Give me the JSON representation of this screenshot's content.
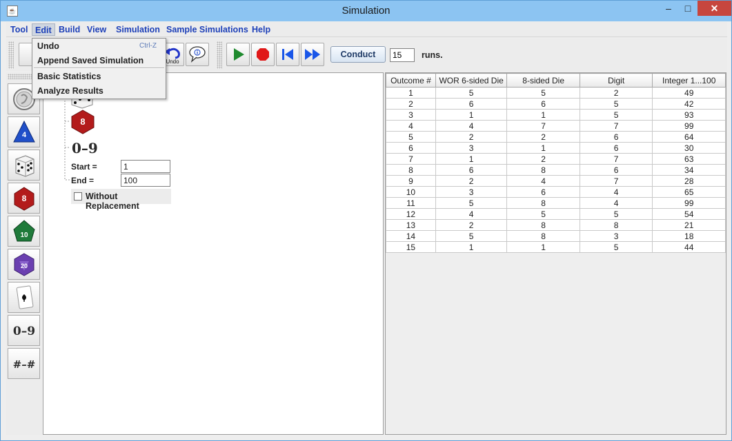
{
  "window": {
    "title": "Simulation",
    "minimize": "–",
    "maximize": "□",
    "close": "✕"
  },
  "menubar": {
    "items": [
      "Tool",
      "Edit",
      "Build",
      "View",
      "Simulation",
      "Sample Simulations",
      "Help"
    ],
    "active": "Edit"
  },
  "edit_menu": {
    "items": [
      {
        "label": "Undo",
        "shortcut": "Ctrl-Z"
      },
      {
        "label": "Append Saved Simulation"
      },
      {
        "label": "Basic Statistics"
      },
      {
        "label": "Analyze Results"
      }
    ]
  },
  "toolbar": {
    "undo_label": "Undo",
    "conduct_label": "Conduct",
    "runs_value": "15",
    "runs_label": "runs."
  },
  "palette": {
    "items": [
      {
        "icon": "coin-icon",
        "label": ""
      },
      {
        "icon": "d4-die-icon",
        "label": "4"
      },
      {
        "icon": "six-sided-die-icon",
        "label": ""
      },
      {
        "icon": "d8-die-icon",
        "label": "8"
      },
      {
        "icon": "d10-die-icon",
        "label": "10"
      },
      {
        "icon": "d20-die-icon",
        "label": "20"
      },
      {
        "icon": "playing-card-icon",
        "label": ""
      },
      {
        "icon": "digit-icon",
        "label": "0–9"
      },
      {
        "icon": "integer-range-icon",
        "label": "#–#"
      }
    ]
  },
  "canvas": {
    "d8_label": "8",
    "digit_label": "0–9",
    "start_label": "Start =",
    "start_value": "1",
    "end_label": "End =",
    "end_value": "100",
    "without_replacement_label": "Without Replacement"
  },
  "results": {
    "columns": [
      "Outcome #",
      "WOR 6-sided Die",
      "8-sided Die",
      "Digit",
      "Integer 1...100"
    ],
    "rows": [
      [
        "1",
        "5",
        "5",
        "2",
        "49"
      ],
      [
        "2",
        "6",
        "6",
        "5",
        "42"
      ],
      [
        "3",
        "1",
        "1",
        "5",
        "93"
      ],
      [
        "4",
        "4",
        "7",
        "7",
        "99"
      ],
      [
        "5",
        "2",
        "2",
        "6",
        "64"
      ],
      [
        "6",
        "3",
        "1",
        "6",
        "30"
      ],
      [
        "7",
        "1",
        "2",
        "7",
        "63"
      ],
      [
        "8",
        "6",
        "8",
        "6",
        "34"
      ],
      [
        "9",
        "2",
        "4",
        "7",
        "28"
      ],
      [
        "10",
        "3",
        "6",
        "4",
        "65"
      ],
      [
        "11",
        "5",
        "8",
        "4",
        "99"
      ],
      [
        "12",
        "4",
        "5",
        "5",
        "54"
      ],
      [
        "13",
        "2",
        "8",
        "8",
        "21"
      ],
      [
        "14",
        "5",
        "8",
        "3",
        "18"
      ],
      [
        "15",
        "1",
        "1",
        "5",
        "44"
      ]
    ]
  },
  "colors": {
    "menu_text": "#1c3fb8",
    "play": "#1f8a2e",
    "stop": "#e01818",
    "nav": "#1a56e8",
    "close_button": "#c7463e",
    "d8": "#b31b1b",
    "d4": "#1f4fc9",
    "d10": "#1f7a3a",
    "d20": "#6a3fb0"
  }
}
